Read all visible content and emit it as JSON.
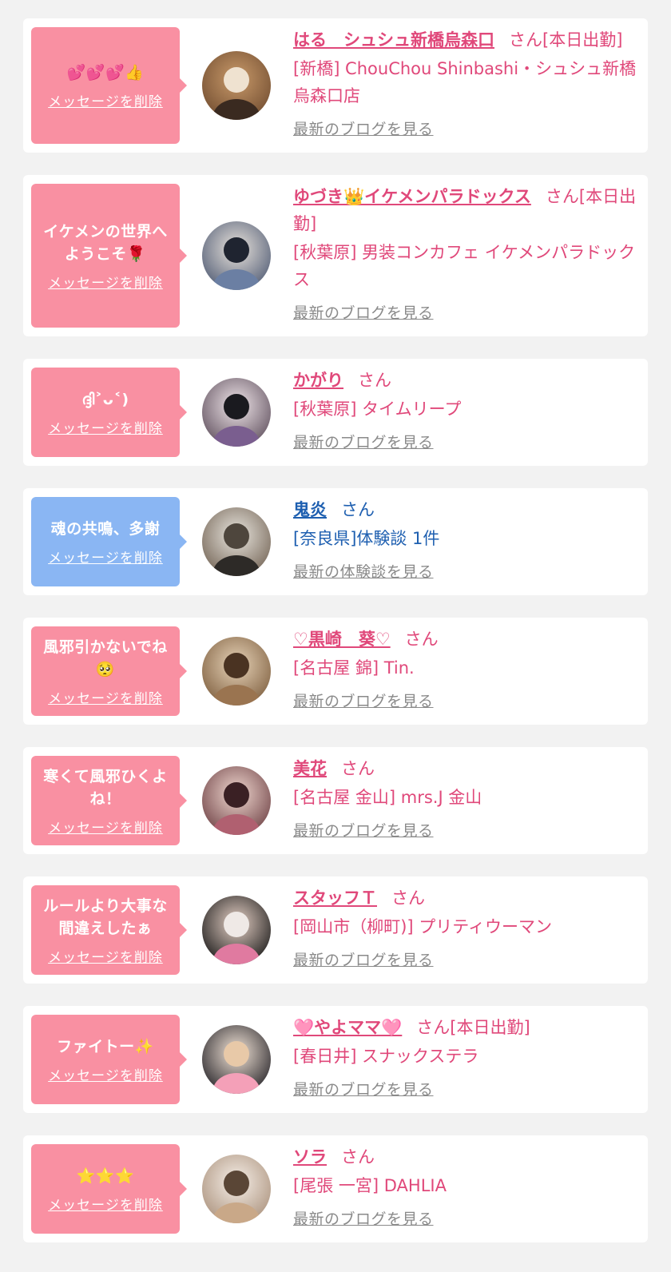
{
  "colors": {
    "bubble_pink": "#f990a2",
    "bubble_blue": "#8ab6f3",
    "text_pink": "#e0487a",
    "text_blue": "#1e5fb0",
    "link_gray": "#8a8a8a"
  },
  "cards": [
    {
      "theme": "pink",
      "height": 168,
      "message": "💕💕💕👍",
      "delete_label": "メッセージを削除",
      "avatar_icon": "avatar-photo-icon",
      "name": "はる　シュシュ新橋烏森口",
      "suffix": "さん[本日出勤]",
      "shop": "[新橋] ChouChou Shinbashi・シュシュ新橋烏森口店",
      "blog_label": "最新のブログを見る"
    },
    {
      "theme": "pink",
      "height": 202,
      "message": "イケメンの世界へようこそ🌹",
      "delete_label": "メッセージを削除",
      "avatar_icon": "avatar-photo-icon",
      "name": "ゆづき👑イケメンパラドックス",
      "suffix": "さん[本日出勤]",
      "shop": "[秋葉原] 男装コンカフェ イケメンパラドックス",
      "blog_label": "最新のブログを見る"
    },
    {
      "theme": "pink",
      "height": 134,
      "message": "ദ്ദി˃ᴗ˂)",
      "delete_label": "メッセージを削除",
      "avatar_icon": "avatar-photo-icon",
      "name": "かがり",
      "suffix": "さん",
      "shop": "[秋葉原] タイムリープ",
      "blog_label": "最新のブログを見る"
    },
    {
      "theme": "blue",
      "height": 134,
      "message": "魂の共鳴、多謝",
      "delete_label": "メッセージを削除",
      "avatar_icon": "avatar-photo-icon",
      "name": "鬼炎",
      "suffix": "さん",
      "shop": "[奈良県]体験談 1件",
      "blog_label": "最新の体験談を見る"
    },
    {
      "theme": "pink",
      "height": 134,
      "message": "風邪引かないでね🥺",
      "delete_label": "メッセージを削除",
      "avatar_icon": "avatar-photo-icon",
      "name": "♡黒崎　葵♡",
      "suffix": "さん",
      "shop": "[名古屋 錦] Tin.",
      "blog_label": "最新のブログを見る"
    },
    {
      "theme": "pink",
      "height": 134,
      "message": "寒くて風邪ひくよね！",
      "delete_label": "メッセージを削除",
      "avatar_icon": "avatar-photo-icon",
      "name": "美花",
      "suffix": "さん",
      "shop": "[名古屋 金山] mrs.J 金山",
      "blog_label": "最新のブログを見る"
    },
    {
      "theme": "pink",
      "height": 134,
      "message": "ルールより大事な間違えしたぁ",
      "delete_label": "メッセージを削除",
      "avatar_icon": "avatar-photo-icon",
      "name": "スタッフＴ",
      "suffix": "さん",
      "shop": "[岡山市（柳町)] プリティウーマン",
      "blog_label": "最新のブログを見る"
    },
    {
      "theme": "pink",
      "height": 134,
      "message": "ファイトー✨",
      "delete_label": "メッセージを削除",
      "avatar_icon": "avatar-photo-icon",
      "name": "🩷やよママ🩷",
      "suffix": "さん[本日出勤]",
      "shop": "[春日井] スナックステラ",
      "blog_label": "最新のブログを見る"
    },
    {
      "theme": "pink",
      "height": 134,
      "message": "⭐⭐⭐",
      "delete_label": "メッセージを削除",
      "avatar_icon": "avatar-photo-icon",
      "name": "ソラ",
      "suffix": "さん",
      "shop": "[尾張 一宮] DAHLIA",
      "blog_label": "最新のブログを見る"
    }
  ]
}
